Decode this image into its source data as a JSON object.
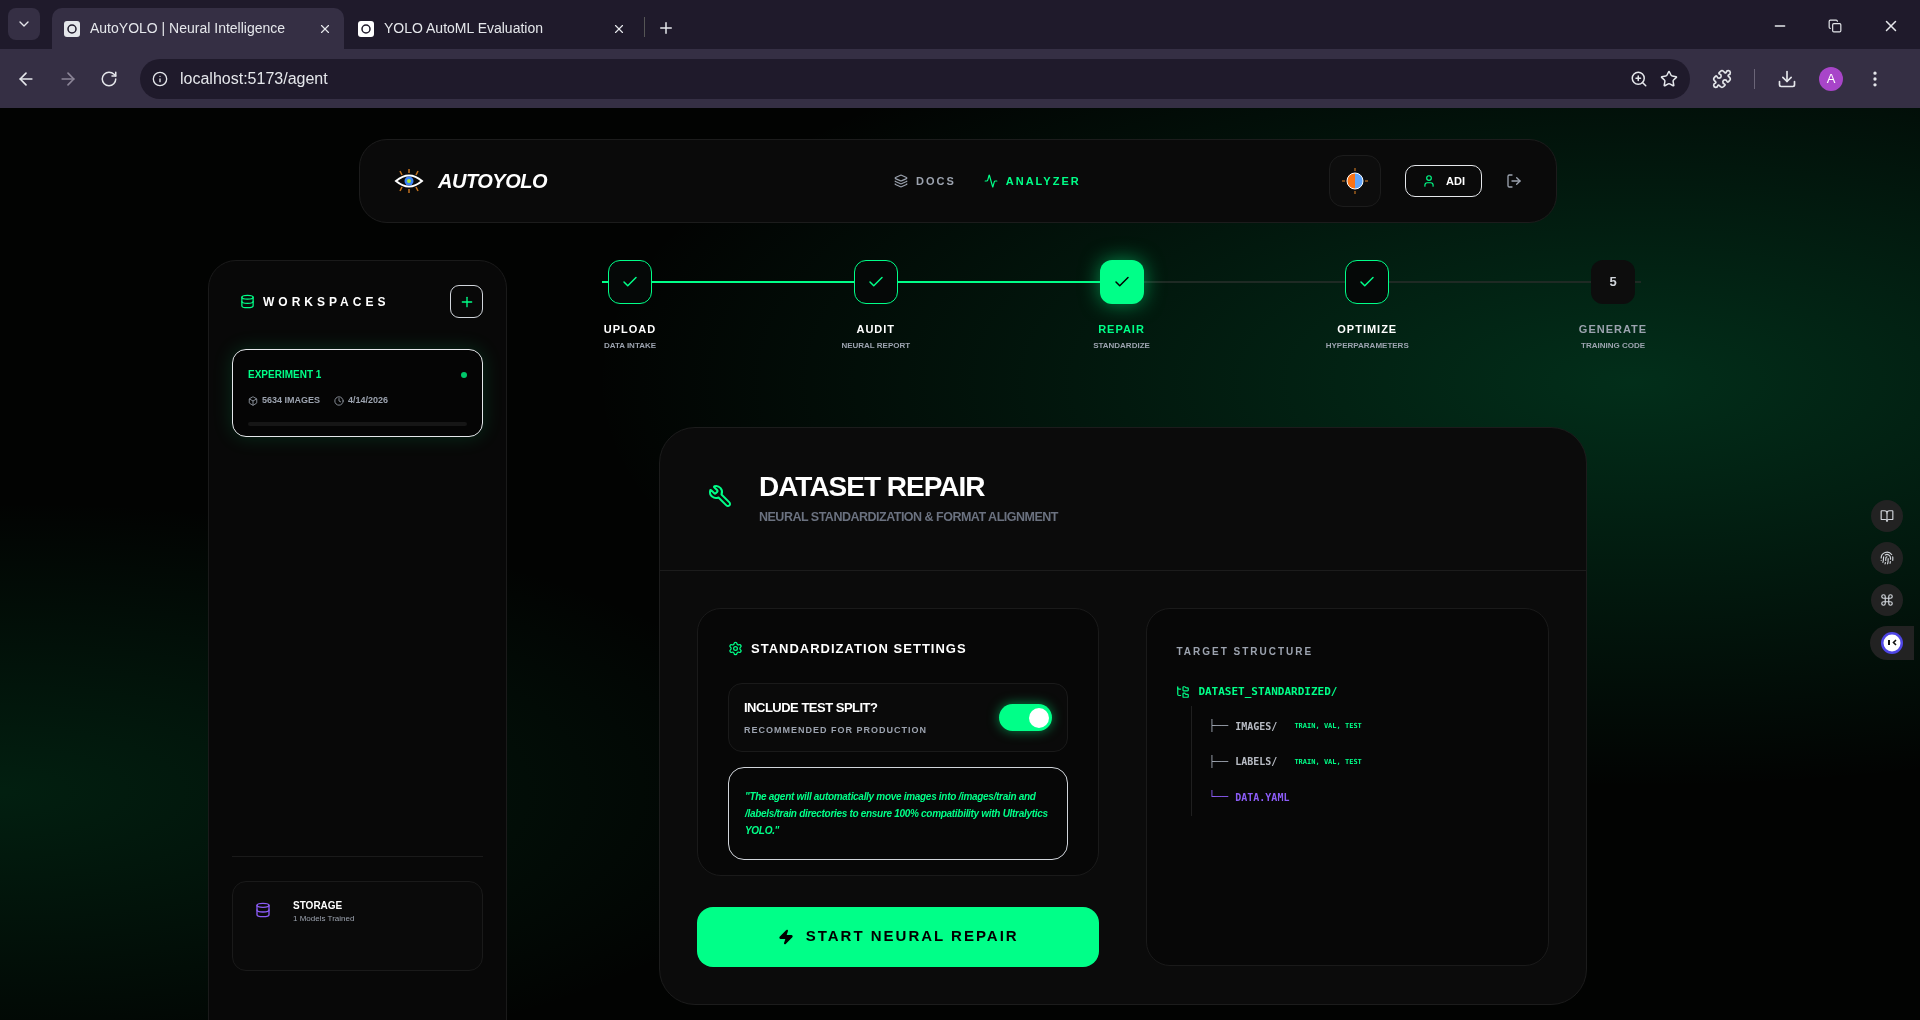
{
  "browser": {
    "tabs": [
      {
        "title": "AutoYOLO | Neural Intelligence",
        "selected": true
      },
      {
        "title": "YOLO AutoML Evaluation",
        "selected": false
      }
    ],
    "url": "localhost:5173/agent",
    "profile": "A"
  },
  "header": {
    "brand": "AUTOYOLO",
    "nav": [
      {
        "label": "DOCS",
        "kind": "docs",
        "selected": false
      },
      {
        "label": "ANALYZER",
        "kind": "analyzer",
        "selected": true
      }
    ],
    "user": "ADI"
  },
  "sidebar": {
    "title": "WORKSPACES",
    "workspaces": [
      {
        "name": "EXPERIMENT 1",
        "images": "5634 IMAGES",
        "date": "4/14/2026",
        "selected": true,
        "online": true
      }
    ],
    "storage": {
      "title": "STORAGE",
      "subtitle": "1 Models Trained"
    }
  },
  "steps": [
    {
      "label": "UPLOAD",
      "sub": "DATA INTAKE",
      "completed": true,
      "selected": false
    },
    {
      "label": "AUDIT",
      "sub": "NEURAL REPORT",
      "completed": true,
      "selected": false
    },
    {
      "label": "REPAIR",
      "sub": "STANDARDIZE",
      "completed": true,
      "selected": true
    },
    {
      "label": "OPTIMIZE",
      "sub": "HYPERPARAMETERS",
      "completed": true,
      "selected": false
    },
    {
      "label": "GENERATE",
      "sub": "TRAINING CODE",
      "completed": false,
      "selected": false,
      "number": "5"
    }
  ],
  "repair": {
    "title": "DATASET REPAIR",
    "subtitle": "NEURAL STANDARDIZATION & FORMAT ALIGNMENT",
    "settings_title": "STANDARDIZATION SETTINGS",
    "toggle": {
      "label": "INCLUDE TEST SPLIT?",
      "hint": "RECOMMENDED FOR PRODUCTION",
      "on": true
    },
    "note": "\"The agent will automatically move images into /images/train and /labels/train directories to ensure 100% compatibility with Ultralytics YOLO.\"",
    "button": "START NEURAL REPAIR"
  },
  "structure": {
    "title": "TARGET STRUCTURE",
    "tree": [
      {
        "name": "DATASET_STANDARDIZED/",
        "kind": "root",
        "children": [
          {
            "branch": "├──",
            "name": "IMAGES/",
            "note": "TRAIN, VAL, TEST",
            "kind": "folder"
          },
          {
            "branch": "├──",
            "name": "LABELS/",
            "note": "TRAIN, VAL, TEST",
            "kind": "folder"
          },
          {
            "branch": "└──",
            "name": "DATA.YAML",
            "kind": "file"
          }
        ]
      }
    ]
  }
}
